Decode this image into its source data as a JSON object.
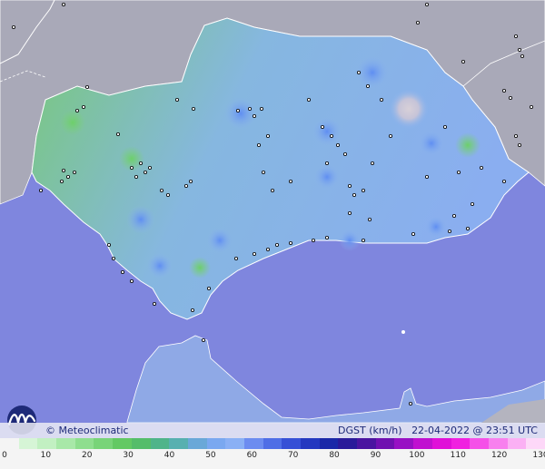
{
  "brand": "© Meteoclimatic",
  "variable_label": "DGST (km/h)",
  "datetime": "22-04-2022 @ 23:51 UTC",
  "scale": {
    "labels": [
      "0",
      "10",
      "20",
      "30",
      "40",
      "50",
      "60",
      "70",
      "80",
      "90",
      "100",
      "110",
      "120",
      "130"
    ],
    "colors": [
      "#f4f4f4",
      "#d6f5d6",
      "#c2f0c2",
      "#a8e8a8",
      "#8ede8e",
      "#78d478",
      "#63c963",
      "#55bd6a",
      "#4fb48a",
      "#57b0b0",
      "#6aa8d8",
      "#7aa8f0",
      "#8ab0f5",
      "#6c8cf0",
      "#4f6ee6",
      "#3650d6",
      "#2438c0",
      "#1a28a8",
      "#2a1a9a",
      "#4a14a0",
      "#7010b0",
      "#9810c4",
      "#c010d0",
      "#e010d8",
      "#f020e0",
      "#f550e8",
      "#f880ee",
      "#fbb0f4",
      "#fdd8f8"
    ]
  },
  "map_colors": {
    "sea": "#7f86de",
    "land_outside": "#a9a9b8",
    "spain_outside": "#b4b4bf",
    "region_green": "#7dcf7c",
    "region_blue": "#8ab2ee",
    "high_wind": "#c7c7cf"
  }
}
